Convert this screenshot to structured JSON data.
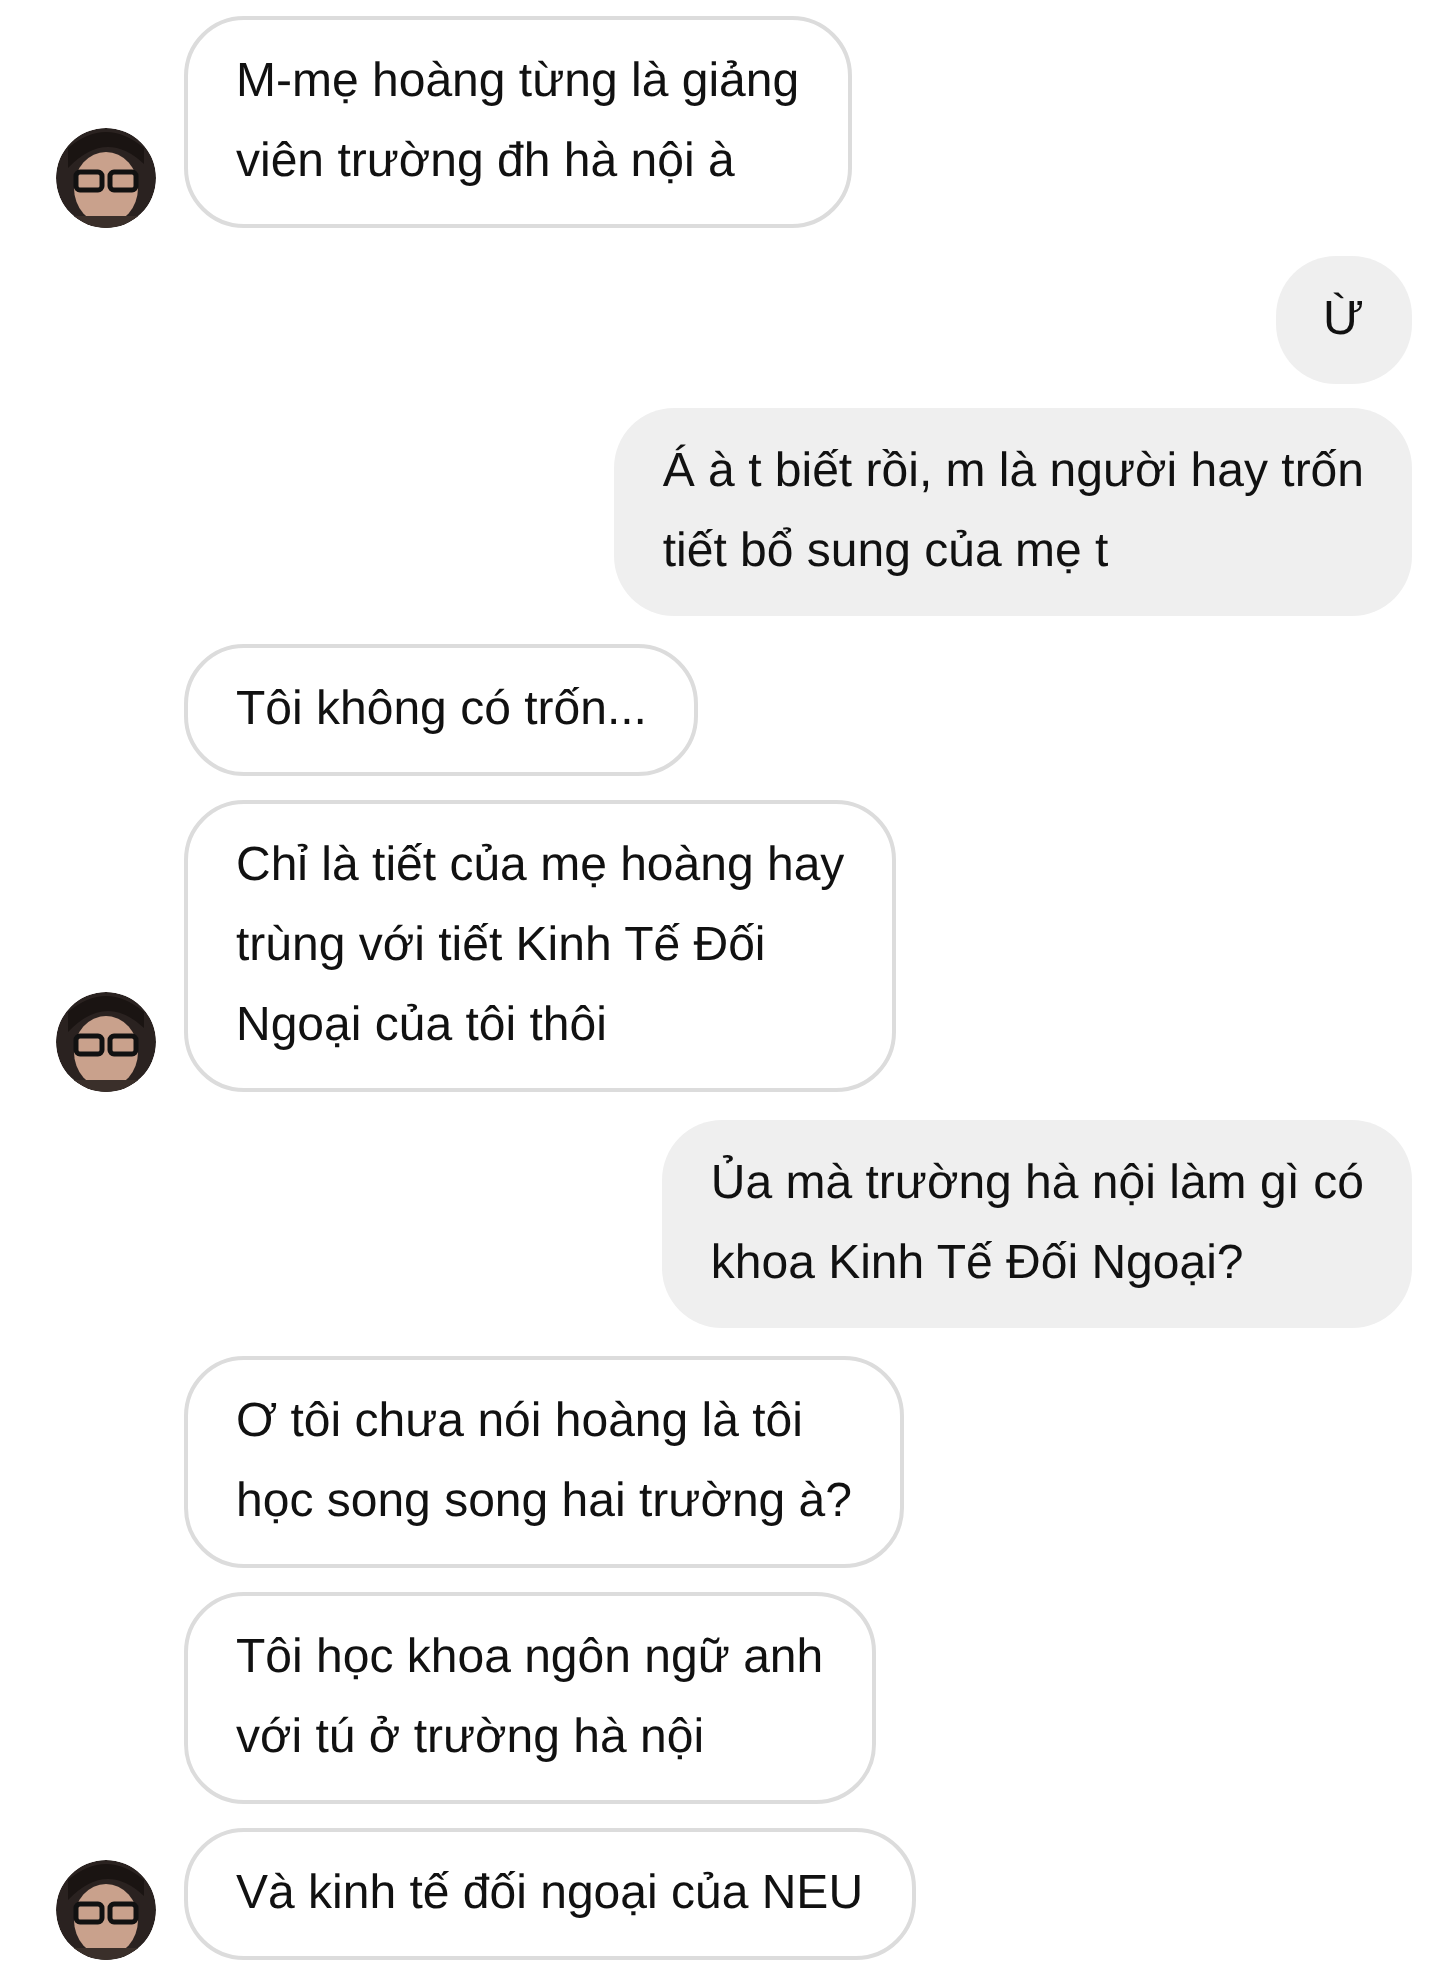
{
  "messages": [
    {
      "kind": "incoming",
      "text": "M-mẹ hoàng từng là giảng\nviên trường đh hà nội à",
      "avatar": true
    },
    {
      "kind": "outgoing",
      "text": "Ừ",
      "avatar": false
    },
    {
      "kind": "outgoing",
      "text": "Á à t biết rồi, m là người hay trốn\ntiết bổ sung của mẹ t",
      "avatar": false
    },
    {
      "kind": "incoming",
      "text": "Tôi không có trốn...",
      "avatar": false
    },
    {
      "kind": "incoming",
      "text": "Chỉ là tiết của mẹ hoàng hay\ntrùng với tiết Kinh Tế Đối\nNgoại của tôi thôi",
      "avatar": true
    },
    {
      "kind": "outgoing",
      "text": "Ủa mà trường hà nội làm gì có\nkhoa Kinh Tế Đối Ngoại?",
      "avatar": false
    },
    {
      "kind": "incoming",
      "text": "Ơ tôi chưa nói hoàng là tôi\nhọc song song hai trường à?",
      "avatar": false
    },
    {
      "kind": "incoming",
      "text": "Tôi học khoa ngôn ngữ anh\nvới tú ở trường hà nội",
      "avatar": false
    },
    {
      "kind": "incoming",
      "text": "Và kinh tế đối ngoại của NEU",
      "avatar": true
    }
  ]
}
